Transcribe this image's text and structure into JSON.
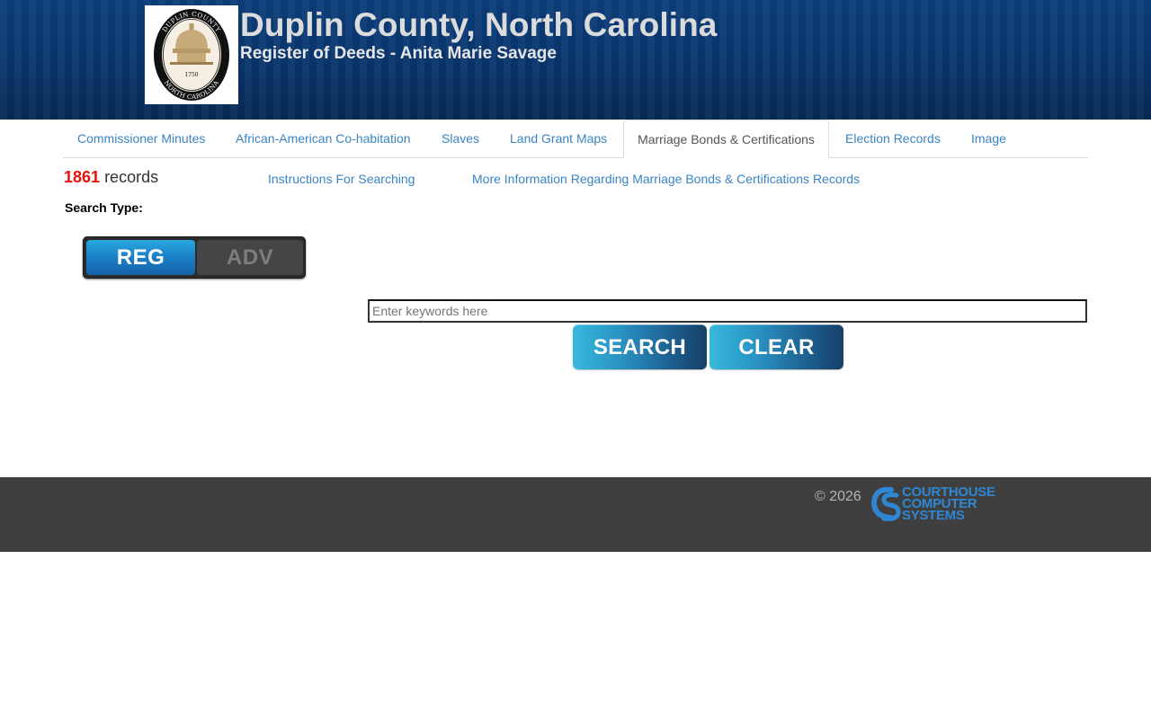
{
  "header": {
    "title": "Duplin County, North Carolina",
    "subtitle": "Register of Deeds - Anita Marie Savage",
    "seal": {
      "top_text": "DUPLIN COUNTY",
      "bottom_text": "NORTH CAROLINA",
      "year": "1750"
    }
  },
  "tabs": [
    {
      "label": "Commissioner Minutes",
      "active": false
    },
    {
      "label": "African-American Co-habitation",
      "active": false
    },
    {
      "label": "Slaves",
      "active": false
    },
    {
      "label": "Land Grant Maps",
      "active": false
    },
    {
      "label": "Marriage Bonds & Certifications",
      "active": true
    },
    {
      "label": "Election Records",
      "active": false
    },
    {
      "label": "Image",
      "active": false
    }
  ],
  "records": {
    "count": "1861",
    "label": "records"
  },
  "links": {
    "instructions": "Instructions For Searching",
    "more_info": "More Information Regarding Marriage Bonds & Certifications Records"
  },
  "search_type": {
    "label": "Search Type:",
    "reg": "REG",
    "adv": "ADV",
    "selected": "REG"
  },
  "search": {
    "placeholder": "Enter keywords here",
    "value": "",
    "search_button": "SEARCH",
    "clear_button": "CLEAR"
  },
  "footer": {
    "copyright": "© 2026",
    "logo_lines": [
      "COURTHOUSE",
      "COMPUTER",
      "SYSTEMS"
    ]
  },
  "colors": {
    "header_bg": "#0a3770",
    "link": "#3a84c4",
    "record_count": "#e8120c",
    "footer_bg": "#3f3f3f",
    "logo_blue": "#2f86d3"
  }
}
